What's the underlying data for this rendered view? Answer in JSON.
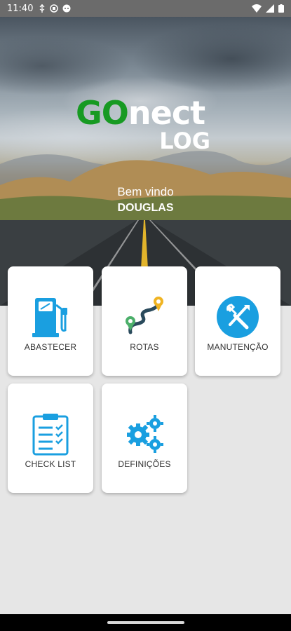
{
  "status_bar": {
    "time": "11:40"
  },
  "header": {
    "logo_go": "GO",
    "logo_nect": "nect",
    "logo_log": "LOG",
    "welcome_text": "Bem vindo",
    "user_name": "DOUGLAS"
  },
  "menu": {
    "tiles": [
      {
        "label": "ABASTECER",
        "icon": "fuel-pump-icon"
      },
      {
        "label": "ROTAS",
        "icon": "route-icon"
      },
      {
        "label": "MANUTENÇÃO",
        "icon": "tools-icon"
      },
      {
        "label": "CHECK LIST",
        "icon": "checklist-icon"
      },
      {
        "label": "DEFINIÇÕES",
        "icon": "gears-icon"
      }
    ]
  },
  "colors": {
    "brand_green": "#179a22",
    "icon_blue": "#1a9fe0"
  }
}
